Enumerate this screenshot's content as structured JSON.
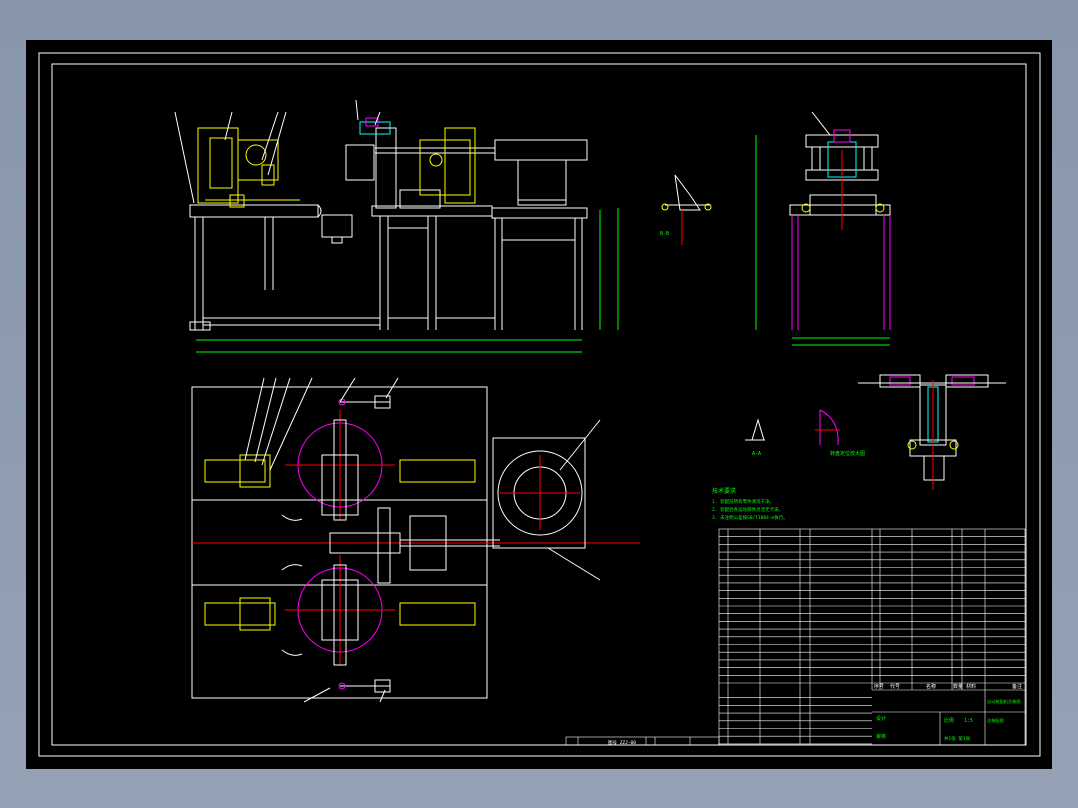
{
  "colors": {
    "background": "#000000",
    "frame": "#ffffff",
    "machine_primary": "#ffffff",
    "machine_secondary": "#ffff00",
    "dimension": "#00ff00",
    "accent": "#ff00ff",
    "center_line": "#ff0000",
    "cyan": "#00ffff",
    "viewport": "#8e9aae"
  },
  "drawing": {
    "notes_heading": "技术要求",
    "notes": [
      "1. 装配前所有零件清洗干净。",
      "2. 装配后各运动部件灵活无卡滞。",
      "3. 未注明公差按GB/T1804-m执行。"
    ],
    "section_label": "A-A",
    "detail_label": "B-B",
    "detail_caption": "转盘定位放大图",
    "title_block": {
      "title_main": "自动装配机总装图",
      "title_sub": "总装配图",
      "designer_label": "设计",
      "checker_label": "审核",
      "scale_label": "比例",
      "sheet_label": "共1张 第1张",
      "scale_value": "1:5"
    },
    "bom_headers": [
      "序号",
      "代号",
      "名称",
      "数量",
      "材料",
      "备注"
    ],
    "bottom_strip_label": "图号 ZZJ-00"
  }
}
